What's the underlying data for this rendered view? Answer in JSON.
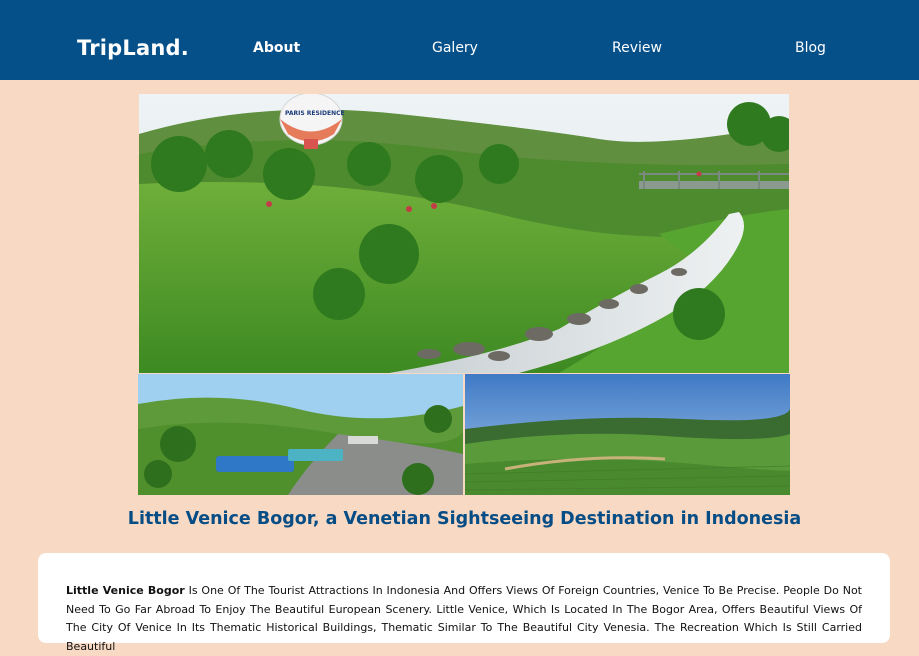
{
  "nav": {
    "brand": "TripLand.",
    "links": [
      "About",
      "Galery",
      "Review",
      "Blog"
    ]
  },
  "hero": {
    "balloon_text": "PARIS RESIDENCE"
  },
  "article": {
    "title": "Little Venice Bogor, a Venetian Sightseeing Destination in Indonesia",
    "lead": "Little Venice Bogor",
    "body": " Is One Of The Tourist Attractions In Indonesia And Offers Views Of Foreign Countries, Venice To Be Precise. People Do Not Need To Go Far Abroad To Enjoy The Beautiful European Scenery. Little Venice, Which Is Located In The Bogor Area, Offers Beautiful Views Of The City Of Venice In Its Thematic Historical Buildings, Thematic Similar To The Beautiful City Venesia. The Recreation Which Is Still Carried Beautiful"
  },
  "colors": {
    "navbar": "#06508a",
    "page_bg": "#f7d9c4",
    "title": "#064d86"
  }
}
